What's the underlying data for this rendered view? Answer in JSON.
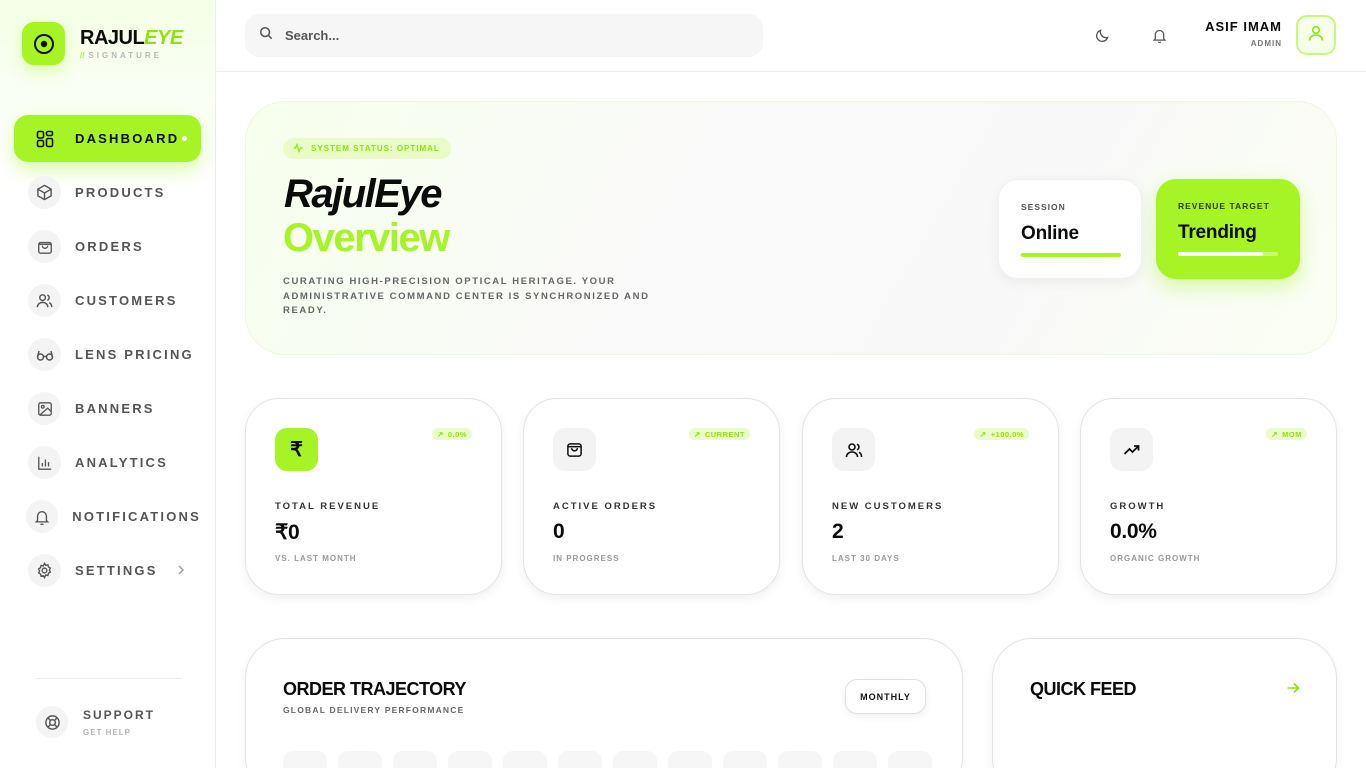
{
  "brand": {
    "name_main": "RAJUL",
    "name_accent": "EYE",
    "slashes": "//",
    "sub": "SIGNATURE"
  },
  "nav": {
    "items": [
      {
        "label": "DASHBOARD",
        "icon": "grid-icon",
        "active": true
      },
      {
        "label": "PRODUCTS",
        "icon": "box-icon"
      },
      {
        "label": "ORDERS",
        "icon": "bag-icon"
      },
      {
        "label": "CUSTOMERS",
        "icon": "users-icon"
      },
      {
        "label": "LENS PRICING",
        "icon": "glasses-icon"
      },
      {
        "label": "BANNERS",
        "icon": "image-icon"
      },
      {
        "label": "ANALYTICS",
        "icon": "bar-chart-icon"
      },
      {
        "label": "NOTIFICATIONS",
        "icon": "bell-icon"
      },
      {
        "label": "SETTINGS",
        "icon": "gear-icon"
      }
    ],
    "support": {
      "title": "SUPPORT",
      "sub": "GET HELP"
    }
  },
  "header": {
    "search_placeholder": "Search...",
    "user": {
      "name": "ASIF IMAM",
      "role": "ADMIN"
    }
  },
  "hero": {
    "status": "SYSTEM STATUS: OPTIMAL",
    "title": "RajulEye",
    "title_accent": "Overview",
    "description": "CURATING HIGH-PRECISION OPTICAL HERITAGE. YOUR ADMINISTRATIVE COMMAND CENTER IS SYNCHRONIZED AND READY.",
    "session": {
      "label": "SESSION",
      "value": "Online",
      "progress": 1.0
    },
    "target": {
      "label": "REVENUE TARGET",
      "value": "Trending",
      "progress": 0.85
    }
  },
  "stats": [
    {
      "label": "TOTAL REVENUE",
      "value": "₹0",
      "sub": "VS. LAST MONTH",
      "badge": "0.0%",
      "icon": "rupee-icon"
    },
    {
      "label": "ACTIVE ORDERS",
      "value": "0",
      "sub": "IN PROGRESS",
      "badge": "CURRENT",
      "icon": "bag-icon"
    },
    {
      "label": "NEW CUSTOMERS",
      "value": "2",
      "sub": "LAST 30 DAYS",
      "badge": "+100.0%",
      "icon": "users-icon"
    },
    {
      "label": "GROWTH",
      "value": "0.0%",
      "sub": "ORGANIC GROWTH",
      "badge": "MOM",
      "icon": "trending-up-icon"
    }
  ],
  "order_trajectory": {
    "title": "ORDER TRAJECTORY",
    "sub": "GLOBAL DELIVERY PERFORMANCE",
    "period": "MONTHLY"
  },
  "quick_feed": {
    "title": "QUICK FEED"
  },
  "colors": {
    "accent": "#a6f425",
    "accent_dark": "#8fe30d"
  }
}
